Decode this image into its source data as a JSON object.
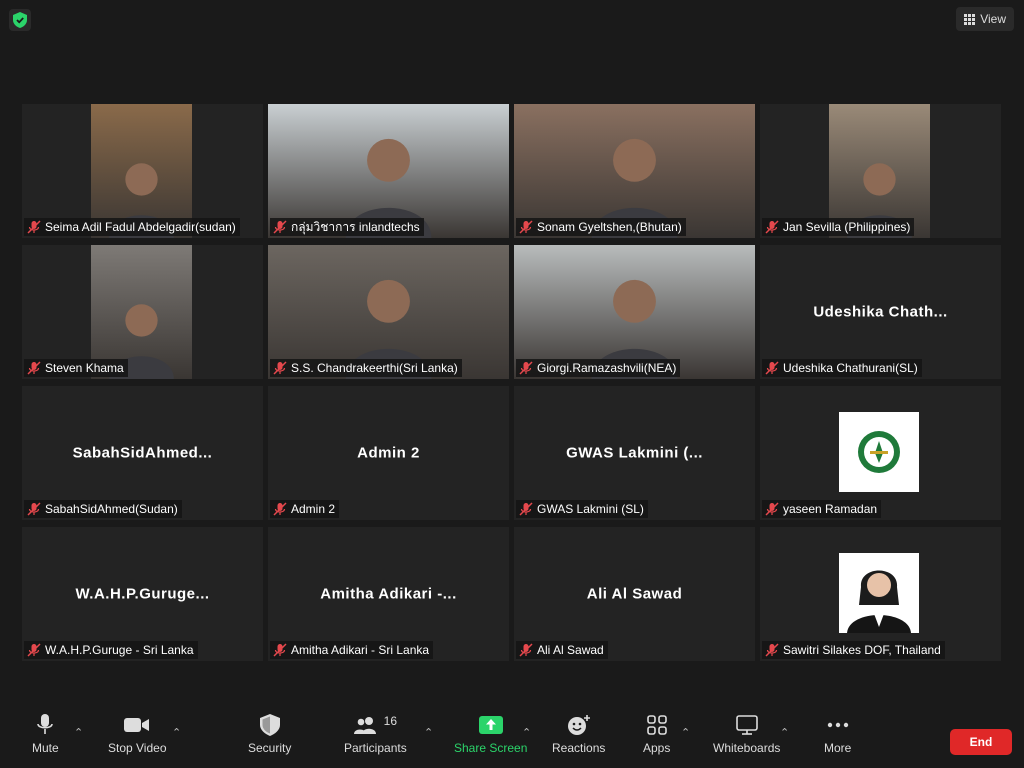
{
  "topbar": {
    "view_label": "View"
  },
  "tiles": [
    {
      "name": "Seima Adil Fadul Abdelgadir(sudan)",
      "display": "",
      "kind": "video",
      "tone": "#8a6a4a"
    },
    {
      "name": "กลุ่มวิชาการ inlandtechs",
      "display": "",
      "kind": "video",
      "tone": "#c9cfd2",
      "active": true
    },
    {
      "name": "Sonam Gyeltshen,(Bhutan)",
      "display": "",
      "kind": "video",
      "tone": "#8a7060"
    },
    {
      "name": "Jan Sevilla (Philippines)",
      "display": "",
      "kind": "video",
      "tone": "#9a8a78"
    },
    {
      "name": "Steven Khama",
      "display": "",
      "kind": "video",
      "tone": "#7e7a76"
    },
    {
      "name": "S.S. Chandrakeerthi(Sri Lanka)",
      "display": "",
      "kind": "video",
      "tone": "#6c6660"
    },
    {
      "name": "Giorgi.Ramazashvili(NEA)",
      "display": "",
      "kind": "video",
      "tone": "#b8bcbc"
    },
    {
      "name": "Udeshika Chathurani(SL)",
      "display": "Udeshika  Chath...",
      "kind": "text"
    },
    {
      "name": "SabahSidAhmed(Sudan)",
      "display": "SabahSidAhmed...",
      "kind": "text"
    },
    {
      "name": "Admin 2",
      "display": "Admin 2",
      "kind": "text"
    },
    {
      "name": "GWAS Lakmini (SL)",
      "display": "GWAS  Lakmini  (...",
      "kind": "text"
    },
    {
      "name": "yaseen Ramadan",
      "display": "",
      "kind": "logo"
    },
    {
      "name": "W.A.H.P.Guruge - Sri Lanka",
      "display": "W.A.H.P.Guruge...",
      "kind": "text"
    },
    {
      "name": "Amitha Adikari - Sri Lanka",
      "display": "Amitha  Adikari  -...",
      "kind": "text"
    },
    {
      "name": "Ali Al Sawad",
      "display": "Ali Al Sawad",
      "kind": "text"
    },
    {
      "name": "Sawitri Silakes DOF, Thailand",
      "display": "",
      "kind": "portrait"
    }
  ],
  "toolbar": {
    "mute": "Mute",
    "stop_video": "Stop Video",
    "security": "Security",
    "participants": "Participants",
    "participant_count": "16",
    "share_screen": "Share Screen",
    "reactions": "Reactions",
    "apps": "Apps",
    "whiteboards": "Whiteboards",
    "more": "More",
    "end": "End"
  },
  "colors": {
    "share_green": "#2bd46a",
    "end_red": "#e02828",
    "active_border": "#e8e25a",
    "mic_off_red": "#e5484d"
  }
}
